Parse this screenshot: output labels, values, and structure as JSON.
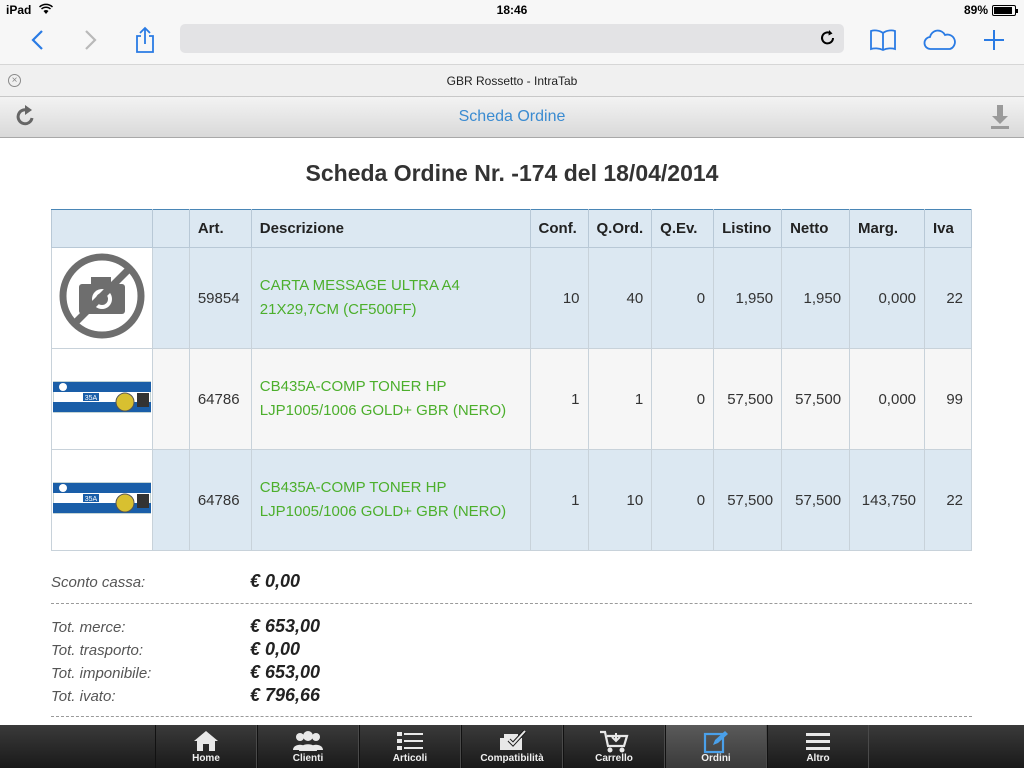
{
  "status": {
    "device": "iPad",
    "time": "18:46",
    "battery": "89%"
  },
  "browser": {
    "tab_title": "GBR Rossetto - IntraTab"
  },
  "header": {
    "title": "Scheda Ordine"
  },
  "order": {
    "title": "Scheda Ordine Nr. -174 del 18/04/2014"
  },
  "table": {
    "headers": [
      "",
      "",
      "Art.",
      "Descrizione",
      "Conf.",
      "Q.Ord.",
      "Q.Ev.",
      "Listino",
      "Netto",
      "Marg.",
      "Iva"
    ],
    "rows": [
      {
        "image": "no-photo-icon",
        "art": "59854",
        "desc1": "CARTA MESSAGE ULTRA A4",
        "desc2": "21X29,7CM (CF500FF)",
        "conf": "10",
        "qord": "40",
        "qev": "0",
        "listino": "1,950",
        "netto": "1,950",
        "marg": "0,000",
        "iva": "22"
      },
      {
        "image": "toner-box",
        "toner_label": "35A",
        "art": "64786",
        "desc1": "CB435A-COMP TONER HP",
        "desc2": "LJP1005/1006 GOLD+ GBR (NERO)",
        "conf": "1",
        "qord": "1",
        "qev": "0",
        "listino": "57,500",
        "netto": "57,500",
        "marg": "0,000",
        "iva": "99"
      },
      {
        "image": "toner-box",
        "toner_label": "35A",
        "art": "64786",
        "desc1": "CB435A-COMP TONER HP",
        "desc2": "LJP1005/1006 GOLD+ GBR (NERO)",
        "conf": "1",
        "qord": "10",
        "qev": "0",
        "listino": "57,500",
        "netto": "57,500",
        "marg": "143,750",
        "iva": "22"
      }
    ]
  },
  "totals": {
    "sconto_label": "Sconto cassa:",
    "sconto_value": "€ 0,00",
    "merce_label": "Tot. merce:",
    "merce_value": "€ 653,00",
    "trasporto_label": "Tot. trasporto:",
    "trasporto_value": "€ 0,00",
    "imponibile_label": "Tot. imponibile:",
    "imponibile_value": "€ 653,00",
    "ivato_label": "Tot. ivato:",
    "ivato_value": "€ 796,66"
  },
  "tabs": [
    {
      "label": "Home",
      "icon": "home-icon"
    },
    {
      "label": "Clienti",
      "icon": "clients-icon"
    },
    {
      "label": "Articoli",
      "icon": "articles-icon"
    },
    {
      "label": "Compatibilità",
      "icon": "compatibility-icon"
    },
    {
      "label": "Carrello",
      "icon": "cart-icon"
    },
    {
      "label": "Ordini",
      "icon": "orders-icon",
      "active": true
    },
    {
      "label": "Altro",
      "icon": "more-icon"
    }
  ],
  "colors": {
    "accent": "#2a7be4",
    "header_title": "#3a8bd1",
    "description": "#4caf2c",
    "row_blue": "#dce8f2"
  }
}
